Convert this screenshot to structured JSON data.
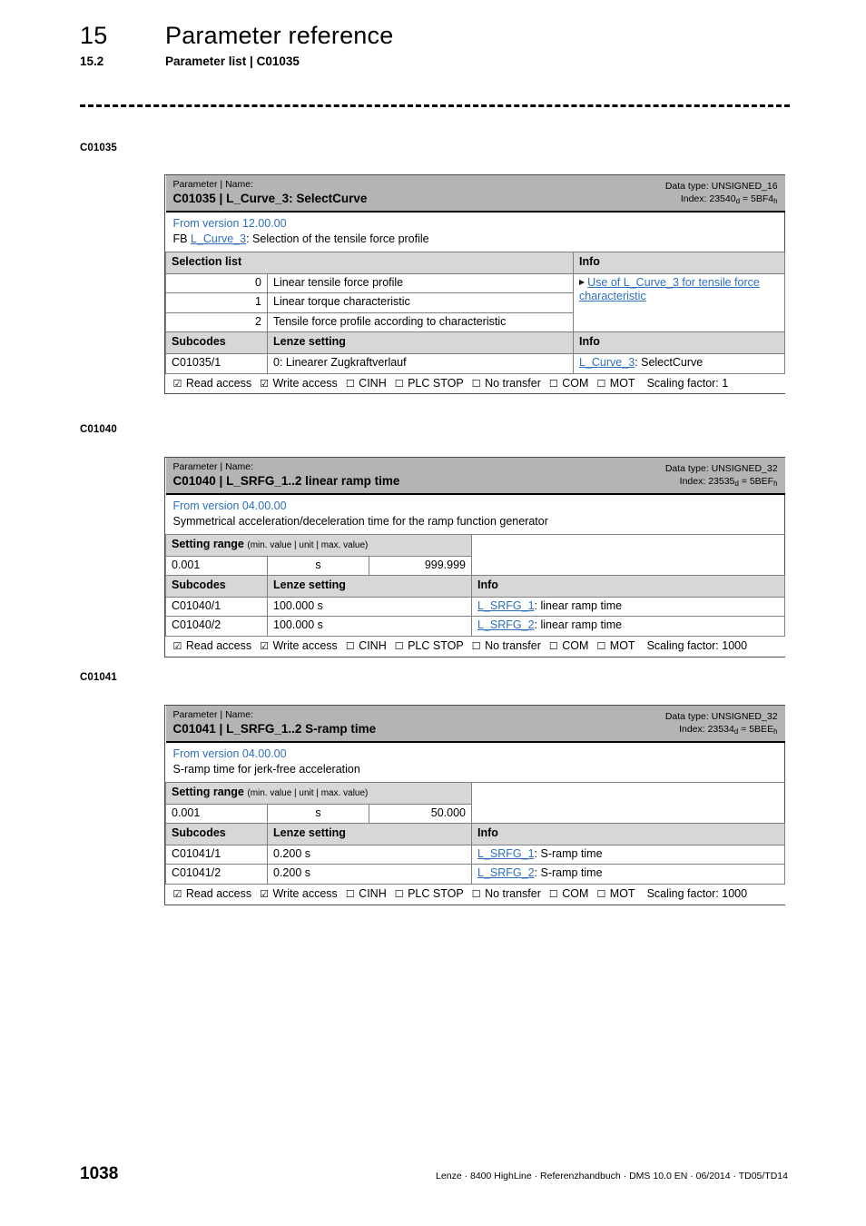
{
  "header": {
    "chapter_number": "15",
    "chapter_title": "Parameter reference",
    "section_number": "15.2",
    "section_title": "Parameter list | C01035"
  },
  "margin_labels": {
    "first": "C01035",
    "second": "C01040",
    "third": "C01041"
  },
  "access_line": {
    "read": "Read access",
    "write": "Write access",
    "cinh": "CINH",
    "plc_stop": "PLC STOP",
    "no_transfer": "No transfer",
    "com": "COM",
    "mot": "MOT",
    "checked_box": "☑",
    "unchecked_box": "☐"
  },
  "tables": [
    {
      "band_small": "Parameter | Name:",
      "band_big": "C01035 | L_Curve_3: SelectCurve",
      "data_type": "Data type: UNSIGNED_16",
      "index_label": "Index: ",
      "index_dec": "23540",
      "index_dec_sub": "d",
      "index_eq": " = ",
      "index_hex": "5BF4",
      "index_hex_sub": "h",
      "version": "From version 12.00.00",
      "description": "FB L_Curve_3: Selection of the tensile force profile",
      "desc_prefix": "FB ",
      "desc_link": "L_Curve_3",
      "desc_suffix": ": Selection of the tensile force profile",
      "list_header": "Selection list",
      "info_header": "Info",
      "selection_rows": [
        {
          "value": "0",
          "text": "Linear tensile force profile"
        },
        {
          "value": "1",
          "text": "Linear torque characteristic"
        },
        {
          "value": "2",
          "text": "Tensile force profile according to characteristic"
        }
      ],
      "info_link": "Use of L_Curve_3 for tensile force characteristic",
      "subcodes_header": "Subcodes",
      "lenze_header": "Lenze setting",
      "sub_info_header": "Info",
      "subcode_rows": [
        {
          "code": "C01035/1",
          "setting": "0: Linearer Zugkraftverlauf",
          "info_link": "L_Curve_3",
          "info_rest": ": SelectCurve"
        }
      ],
      "scaling": "Scaling factor: 1"
    },
    {
      "band_small": "Parameter | Name:",
      "band_big": "C01040 | L_SRFG_1..2 linear ramp time",
      "data_type": "Data type: UNSIGNED_32",
      "index_label": "Index: ",
      "index_dec": "23535",
      "index_dec_sub": "d",
      "index_eq": " = ",
      "index_hex": "5BEF",
      "index_hex_sub": "h",
      "version": "From version 04.00.00",
      "description": "Symmetrical acceleration/deceleration time for the ramp function generator",
      "setting_range_title": "Setting range",
      "setting_range_note": "(min. value | unit | max. value)",
      "min_value": "0.001",
      "unit": "s",
      "max_value": "999.999",
      "subcodes_header": "Subcodes",
      "lenze_header": "Lenze setting",
      "sub_info_header": "Info",
      "subcode_rows": [
        {
          "code": "C01040/1",
          "setting": "100.000 s",
          "info_link": "L_SRFG_1",
          "info_rest": ": linear ramp time"
        },
        {
          "code": "C01040/2",
          "setting": "100.000 s",
          "info_link": "L_SRFG_2",
          "info_rest": ": linear ramp time"
        }
      ],
      "scaling": "Scaling factor: 1000"
    },
    {
      "band_small": "Parameter | Name:",
      "band_big": "C01041 | L_SRFG_1..2 S-ramp time",
      "data_type": "Data type: UNSIGNED_32",
      "index_label": "Index: ",
      "index_dec": "23534",
      "index_dec_sub": "d",
      "index_eq": " = ",
      "index_hex": "5BEE",
      "index_hex_sub": "h",
      "version": "From version 04.00.00",
      "description": "S-ramp time for jerk-free acceleration",
      "setting_range_title": "Setting range",
      "setting_range_note": "(min. value | unit | max. value)",
      "min_value": "0.001",
      "unit": "s",
      "max_value": "50.000",
      "subcodes_header": "Subcodes",
      "lenze_header": "Lenze setting",
      "sub_info_header": "Info",
      "subcode_rows": [
        {
          "code": "C01041/1",
          "setting": "0.200 s",
          "info_link": "L_SRFG_1",
          "info_rest": ": S-ramp time"
        },
        {
          "code": "C01041/2",
          "setting": "0.200 s",
          "info_link": "L_SRFG_2",
          "info_rest": ": S-ramp time"
        }
      ],
      "scaling": "Scaling factor: 1000"
    }
  ],
  "footer": {
    "page_number": "1038",
    "imprint": "Lenze · 8400 HighLine · Referenzhandbuch · DMS 10.0 EN · 06/2014 · TD05/TD14"
  }
}
